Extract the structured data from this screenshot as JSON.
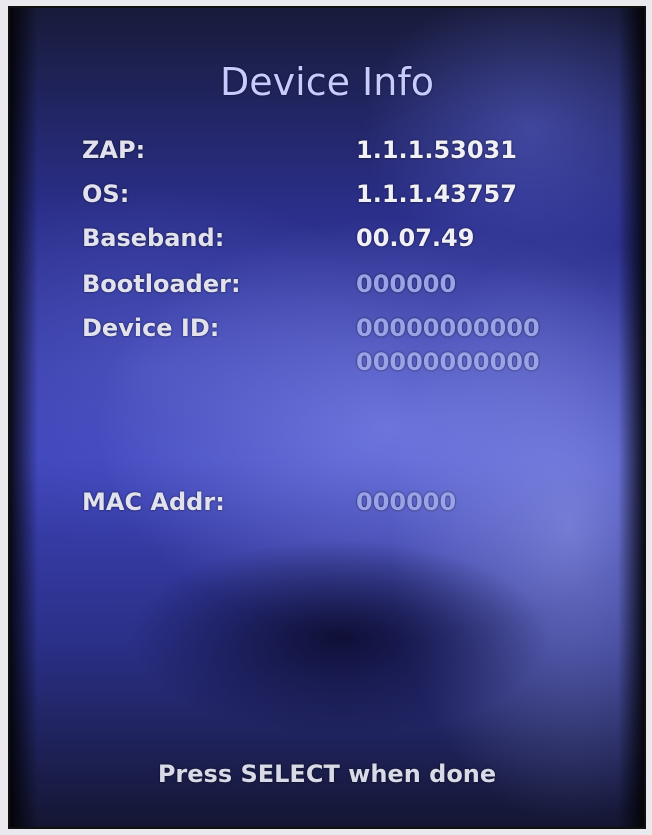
{
  "title": "Device Info",
  "rows": {
    "zap": {
      "label": "ZAP:",
      "value": "1.1.1.53031"
    },
    "os": {
      "label": "OS:",
      "value": "1.1.1.43757"
    },
    "baseband": {
      "label": "Baseband:",
      "value": "00.07.49"
    },
    "bootloader": {
      "label": "Bootloader:",
      "value": "000000"
    },
    "device_id": {
      "label": "Device ID:",
      "value_line1": "00000000000",
      "value_line2": "00000000000"
    },
    "mac": {
      "label": "MAC Addr:",
      "value": "000000"
    }
  },
  "footer": "Press SELECT when done",
  "colors": {
    "title": "#c7cbff",
    "label": "#e2e2ee",
    "value_bright": "#f0f0f6",
    "value_dim": "#9aa2e8",
    "background_accent": "#3d43b8"
  }
}
